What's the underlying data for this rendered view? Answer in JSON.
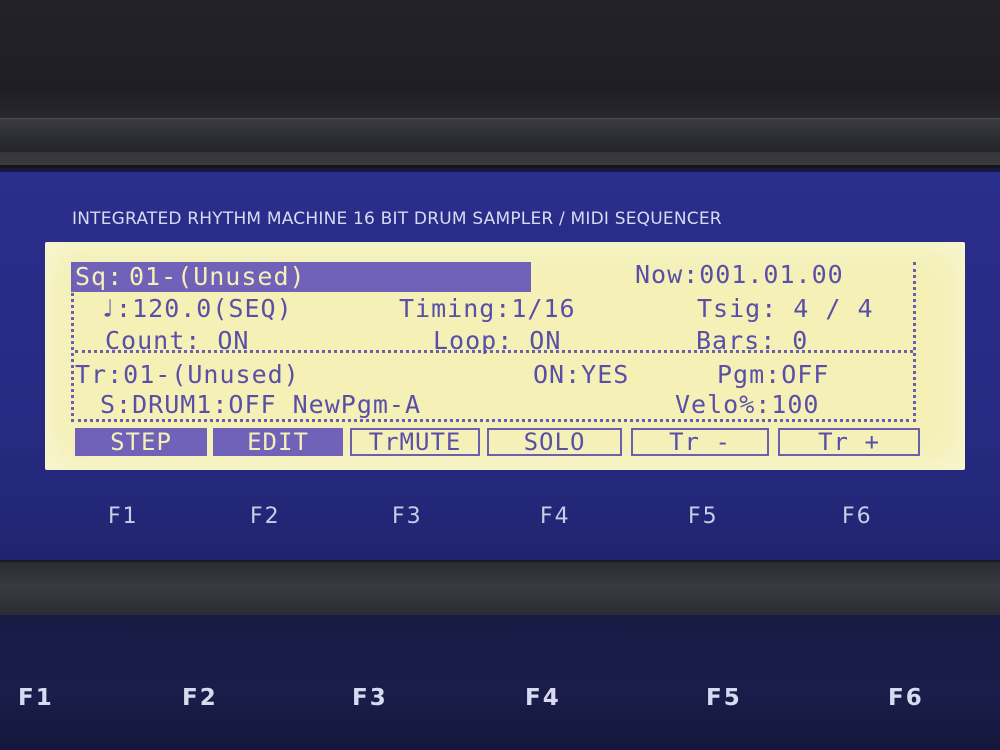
{
  "panel": {
    "title": "INTEGRATED RHYTHM MACHINE  16 BIT DRUM SAMPLER / MIDI SEQUENCER"
  },
  "lcd": {
    "sequence": {
      "label": "Sq:",
      "value": "01-(Unused)"
    },
    "now": "Now:001.01.00",
    "tempo": "♩:120.0(SEQ)",
    "timing": "Timing:1/16",
    "tsig": "Tsig: 4 / 4",
    "count": "Count: ON",
    "loop": "Loop: ON",
    "bars": "Bars: 0",
    "track": "Tr:01-(Unused)",
    "on": "ON:YES",
    "pgm": "Pgm:OFF",
    "sample": "S:DRUM1:OFF NewPgm-A",
    "velo": "Velo%:100"
  },
  "soft_keys": [
    {
      "label": "STEP",
      "active": true
    },
    {
      "label": "EDIT",
      "active": true
    },
    {
      "label": "TrMUTE",
      "active": false
    },
    {
      "label": "SOLO",
      "active": false
    },
    {
      "label": "Tr -",
      "active": false
    },
    {
      "label": "Tr +",
      "active": false
    }
  ],
  "fkey_labels": [
    "F1",
    "F2",
    "F3",
    "F4",
    "F5",
    "F6"
  ],
  "hardware_buttons": [
    "F1",
    "F2",
    "F3",
    "F4",
    "F5",
    "F6"
  ],
  "colors": {
    "lcd_background": "#f4f0b6",
    "lcd_text": "#5a4fa8",
    "lcd_highlight": "#6f62b8",
    "panel_blue": "#2a2e8c"
  }
}
